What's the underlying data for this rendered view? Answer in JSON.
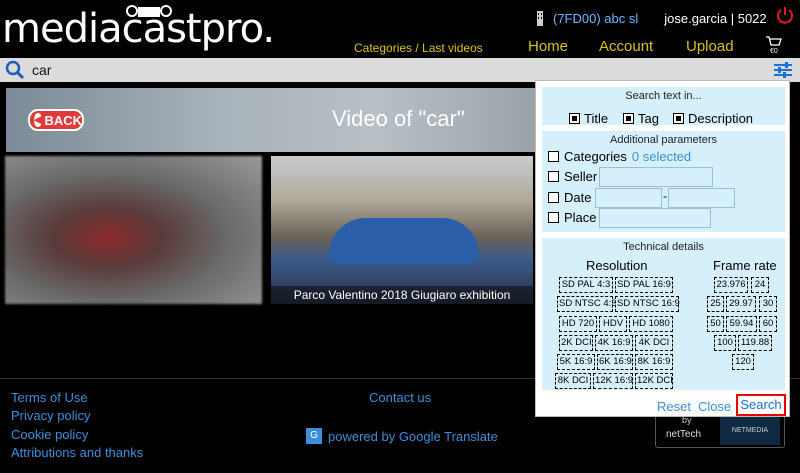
{
  "header": {
    "logo_text": "mediacastpro.",
    "company": "(7FD00) abc sl",
    "user": "jose.garcia | 5022",
    "breadcrumb": "Categories / Last videos",
    "nav": {
      "home": "Home",
      "account": "Account",
      "upload": "Upload"
    },
    "cart_amount": "€0",
    "icons": [
      "camera-icon",
      "building-icon",
      "power-icon",
      "cart-icon"
    ]
  },
  "search": {
    "value": "car",
    "placeholder": ""
  },
  "banner": {
    "back_label": "BACK",
    "title": "Video of \"car\""
  },
  "videos": [
    {
      "caption": ""
    },
    {
      "caption": "Parco Valentino 2018 Giugiaro exhibition"
    }
  ],
  "footer": {
    "links": [
      "Terms of Use",
      "Privacy policy",
      "Cookie policy",
      "Attributions and thanks"
    ],
    "contact": "Contact us",
    "translate": "powered by Google Translate",
    "by": "by",
    "nettech": "netTech",
    "badge": "NETMEDIA"
  },
  "panel": {
    "search_text_title": "Search text in...",
    "search_text_options": [
      {
        "label": "Title",
        "checked": true
      },
      {
        "label": "Tag",
        "checked": true
      },
      {
        "label": "Description",
        "checked": true
      }
    ],
    "additional_title": "Additional parameters",
    "categories_label": "Categories",
    "categories_selected": "0 selected",
    "seller_label": "Seller",
    "date_label": "Date",
    "date_separator": "-",
    "place_label": "Place",
    "technical_title": "Technical details",
    "resolution_title": "Resolution",
    "frame_rate_title": "Frame rate",
    "resolutions": [
      "SD PAL 4:3",
      "SD PAL 16:9",
      "SD NTSC 4:3",
      "SD NTSC 16:9",
      "HD 720",
      "HDV",
      "HD 1080",
      "2K DCI",
      "4K 16:9",
      "4K DCI",
      "5K 16:9",
      "6K 16:9",
      "8K 16:9",
      "8K DCI",
      "12K 16:9",
      "12K DCI"
    ],
    "frame_rates": [
      "23.976",
      "24",
      "25",
      "29.97",
      "30",
      "50",
      "59.94",
      "60",
      "100",
      "119.88",
      "120"
    ],
    "reset": "Reset",
    "close": "Close",
    "search": "Search"
  },
  "colors": {
    "accent_yellow": "#d9c21a",
    "link_blue": "#3a8fd8",
    "panel_bg": "#d6f0fb",
    "highlight_red": "#e00000"
  }
}
